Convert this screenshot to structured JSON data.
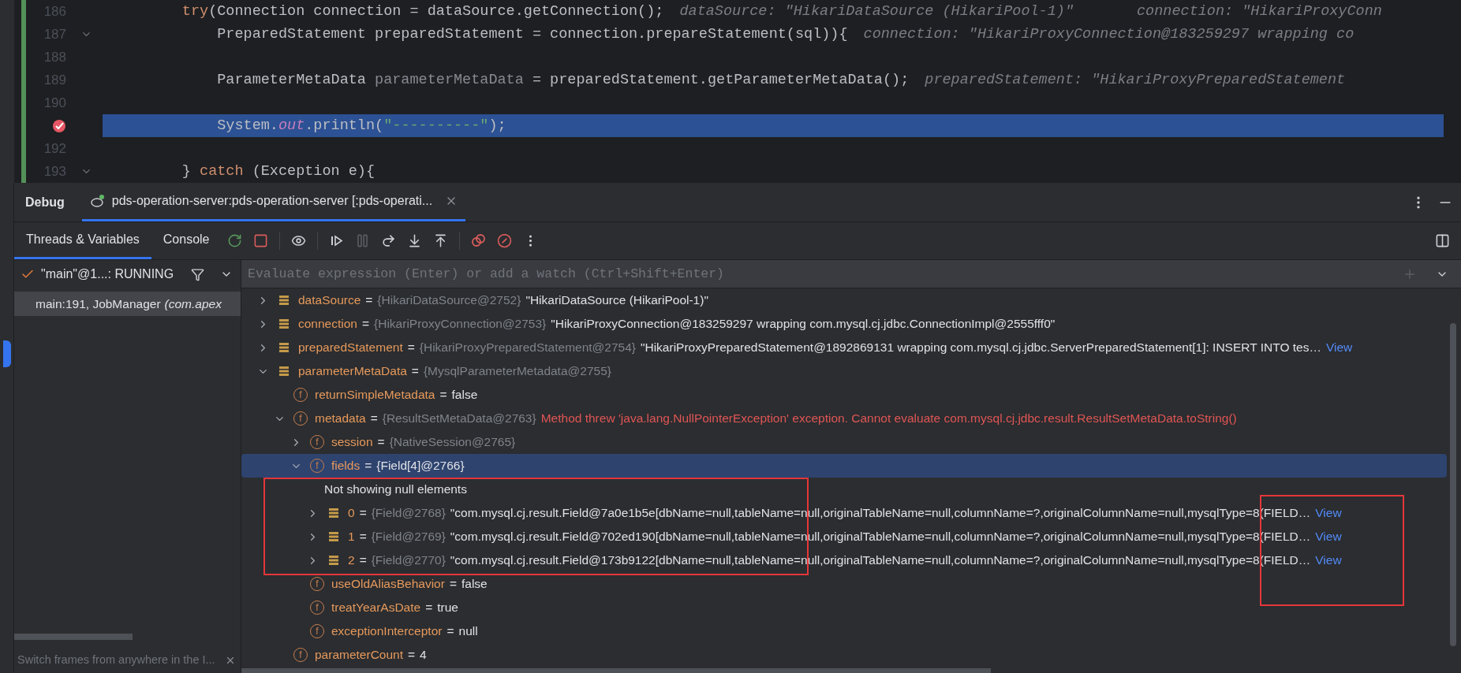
{
  "editor": {
    "lines": [
      {
        "number": "186",
        "segments": [
          {
            "text": "        try",
            "kind": "keyword"
          },
          {
            "text": "(Connection connection = dataSource.getConnection();",
            "kind": "plain"
          }
        ],
        "hints": [
          "dataSource: \"HikariDataSource (HikariPool-1)\"",
          "connection: \"HikariProxyConn"
        ],
        "current": false,
        "breakpoint": false,
        "fold": false
      },
      {
        "number": "187",
        "segments": [
          {
            "text": "            PreparedStatement preparedStatement = connection.prepareStatement(sql)){",
            "kind": "plain"
          }
        ],
        "hints": [
          "connection: \"HikariProxyConnection@183259297 wrapping co"
        ],
        "current": false,
        "breakpoint": false,
        "fold": true
      },
      {
        "number": "188",
        "current": false,
        "breakpoint": false,
        "fold": false
      },
      {
        "number": "189",
        "segments": [
          {
            "text": "            ParameterMetaData ",
            "kind": "plain"
          },
          {
            "text": "parameterMetaData",
            "kind": "unused"
          },
          {
            "text": " = preparedStatement.getParameterMetaData();",
            "kind": "plain"
          }
        ],
        "hints": [
          "preparedStatement: \"HikariProxyPreparedStatement"
        ],
        "current": false,
        "breakpoint": false,
        "fold": false
      },
      {
        "number": "190",
        "current": false,
        "breakpoint": false,
        "fold": false
      },
      {
        "segments": [
          {
            "text": "            System.",
            "kind": "plain"
          },
          {
            "text": "out",
            "kind": "static"
          },
          {
            "text": ".println(",
            "kind": "plain"
          },
          {
            "text": "\"----------\"",
            "kind": "string"
          },
          {
            "text": ");",
            "kind": "plain"
          }
        ],
        "current": true,
        "breakpoint": true,
        "fold": false
      },
      {
        "number": "192",
        "current": false,
        "breakpoint": false,
        "fold": false
      },
      {
        "number": "193",
        "segments": [
          {
            "text": "        } ",
            "kind": "plain"
          },
          {
            "text": "catch",
            "kind": "keyword"
          },
          {
            "text": " (Exception e){",
            "kind": "plain"
          }
        ],
        "current": false,
        "breakpoint": false,
        "fold": true
      }
    ]
  },
  "debug": {
    "title": "Debug",
    "session_tab": {
      "label": "pds-operation-server:pds-operation-server [:pds-operati...",
      "selected": true
    },
    "view_tabs": [
      {
        "label": "Threads & Variables",
        "selected": true
      },
      {
        "label": "Console",
        "selected": false
      }
    ],
    "toolbar": [
      {
        "kind": "rerun",
        "disabled": false
      },
      {
        "kind": "stop",
        "disabled": false
      },
      {
        "kind": "watch",
        "disabled": false
      },
      {
        "kind": "resume",
        "disabled": false
      },
      {
        "kind": "pause",
        "disabled": true
      },
      {
        "kind": "step-over",
        "disabled": false
      },
      {
        "kind": "step-into",
        "disabled": false
      },
      {
        "kind": "step-out",
        "disabled": false
      },
      {
        "kind": "breakpoints",
        "disabled": false
      },
      {
        "kind": "mute",
        "disabled": false
      },
      {
        "kind": "more",
        "disabled": false
      }
    ],
    "threads": {
      "selector": "\"main\"@1...: RUNNING",
      "frames": [
        {
          "method": "main:191, JobManager",
          "location": "(com.apex",
          "selected": true
        }
      ],
      "tip": "Switch frames from anywhere in the I..."
    },
    "variables": {
      "placeholder": "Evaluate expression (Enter) or add a watch (Ctrl+Shift+Enter)",
      "rows": [
        {
          "kind": "variable",
          "name": "dataSource",
          "sep": "=",
          "type": "{HikariDataSource@2752}",
          "value": "\"HikariDataSource (HikariPool-1)\"",
          "expanded": false,
          "selected": false
        },
        {
          "kind": "variable",
          "name": "connection",
          "sep": "=",
          "type": "{HikariProxyConnection@2753}",
          "value": "\"HikariProxyConnection@183259297 wrapping com.mysql.cj.jdbc.ConnectionImpl@2555fff0\"",
          "expanded": false,
          "selected": false
        },
        {
          "kind": "variable",
          "name": "preparedStatement",
          "sep": "=",
          "type": "{HikariProxyPreparedStatement@2754}",
          "value": "\"HikariProxyPreparedStatement@1892869131 wrapping com.mysql.cj.jdbc.ServerPreparedStatement[1]: INSERT INTO tes…",
          "link": "View",
          "expanded": false,
          "selected": false
        },
        {
          "kind": "variable",
          "name": "parameterMetaData",
          "sep": "=",
          "type": "{MysqlParameterMetadata@2755}",
          "expanded": true,
          "selected": false,
          "children": [
            {
              "kind": "field",
              "badge": "f",
              "name": "returnSimpleMetadata",
              "sep": "=",
              "value": "false",
              "selected": false
            },
            {
              "kind": "field",
              "badge": "f",
              "name": "metadata",
              "sep": "=",
              "type": "{ResultSetMetaData@2763}",
              "error": "Method threw 'java.lang.NullPointerException' exception. Cannot evaluate com.mysql.cj.jdbc.result.ResultSetMetaData.toString()",
              "expanded": true,
              "selected": false,
              "children": [
                {
                  "kind": "field",
                  "badge": "f",
                  "name": "session",
                  "sep": "=",
                  "type": "{NativeSession@2765}",
                  "expanded": false,
                  "selected": false
                },
                {
                  "kind": "field",
                  "badge": "f",
                  "name": "fields",
                  "sep": "=",
                  "value": "{Field[4]@2766}",
                  "expanded": true,
                  "selected": true,
                  "children": [
                    {
                      "kind": "note",
                      "text": "Not showing null elements"
                    },
                    {
                      "kind": "variable",
                      "name": "0",
                      "sep": "=",
                      "type": "{Field@2768}",
                      "value": "\"com.mysql.cj.result.Field@7a0e1b5e[dbName=null,tableName=null,originalTableName=null,columnName=?,originalColumnName=null,mysqlType=8(FIELD…",
                      "link": "View",
                      "expanded": false,
                      "selected": false
                    },
                    {
                      "kind": "variable",
                      "name": "1",
                      "sep": "=",
                      "type": "{Field@2769}",
                      "value": "\"com.mysql.cj.result.Field@702ed190[dbName=null,tableName=null,originalTableName=null,columnName=?,originalColumnName=null,mysqlType=8(FIELD…",
                      "link": "View",
                      "expanded": false,
                      "selected": false
                    },
                    {
                      "kind": "variable",
                      "name": "2",
                      "sep": "=",
                      "type": "{Field@2770}",
                      "value": "\"com.mysql.cj.result.Field@173b9122[dbName=null,tableName=null,originalTableName=null,columnName=?,originalColumnName=null,mysqlType=8(FIELD…",
                      "link": "View",
                      "expanded": false,
                      "selected": false
                    }
                  ]
                },
                {
                  "kind": "field",
                  "badge": "f",
                  "name": "useOldAliasBehavior",
                  "sep": "=",
                  "value": "false",
                  "selected": false
                },
                {
                  "kind": "field",
                  "badge": "f",
                  "name": "treatYearAsDate",
                  "sep": "=",
                  "value": "true",
                  "selected": false
                },
                {
                  "kind": "field",
                  "badge": "f",
                  "name": "exceptionInterceptor",
                  "sep": "=",
                  "value": "null",
                  "selected": false
                }
              ]
            },
            {
              "kind": "field",
              "badge": "f",
              "name": "parameterCount",
              "sep": "=",
              "value": "4",
              "selected": false
            }
          ]
        }
      ]
    }
  }
}
